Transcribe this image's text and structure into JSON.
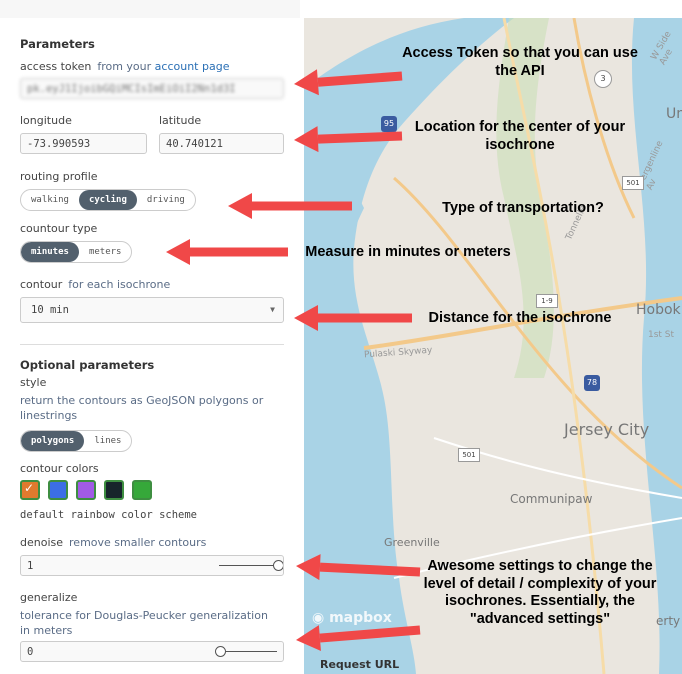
{
  "panel": {
    "parameters_title": "Parameters",
    "access_token": {
      "label": "access token",
      "hint": "from your",
      "link": "account page",
      "value": "pk.eyJ1IjoibGQiMCIsImEiOiI2Nn1d3I"
    },
    "longitude": {
      "label": "longitude",
      "value": "-73.990593"
    },
    "latitude": {
      "label": "latitude",
      "value": "40.740121"
    },
    "routing_profile": {
      "label": "routing profile",
      "options": [
        "walking",
        "cycling",
        "driving"
      ],
      "selected": "cycling"
    },
    "contour_type": {
      "label": "countour type",
      "options": [
        "minutes",
        "meters"
      ],
      "selected": "minutes"
    },
    "contour": {
      "label": "contour",
      "hint": "for each isochrone",
      "value": "10 min"
    },
    "optional_title": "Optional parameters",
    "style": {
      "label": "style",
      "description": "return the contours as GeoJSON polygons or linestrings",
      "options": [
        "polygons",
        "lines"
      ],
      "selected": "polygons"
    },
    "contour_colors": {
      "label": "contour colors",
      "caption": "default rainbow color scheme",
      "swatches": [
        "#e07a2e",
        "#3c6ee6",
        "#a15be6",
        "#17252b",
        "#36a83a"
      ]
    },
    "denoise": {
      "label": "denoise",
      "hint": "remove smaller contours",
      "value": "1",
      "slider_fraction": 1.0
    },
    "generalize": {
      "label": "generalize",
      "description": "tolerance for Douglas-Peucker generalization in meters",
      "value": "0",
      "slider_fraction": 0.0
    },
    "request_url": "Request URL"
  },
  "map": {
    "labels": [
      "Jersey City",
      "Hobok",
      "Communipaw",
      "Greenville",
      "Pulaski Skyway",
      "Tonnelle",
      "Bergenline Av",
      "W Side Ave",
      "1st St",
      "Un",
      "erty"
    ],
    "shields": [
      "95",
      "3",
      "501",
      "1-9",
      "78",
      "501"
    ],
    "brand": "mapbox"
  },
  "annotations": [
    "Access Token so that you can use the API",
    "Location for the center of your isochrone",
    "Type of transportation?",
    "Measure in minutes or meters",
    "Distance for the isochrone",
    "Awesome settings to change the level of detail / complexity of your isochrones. Essentially, the \"advanced settings\""
  ],
  "colors": {
    "arrow": "#f04848",
    "map_water": "#a9d3e6",
    "map_land": "#eae6df",
    "toggle_on": "#52606d"
  }
}
